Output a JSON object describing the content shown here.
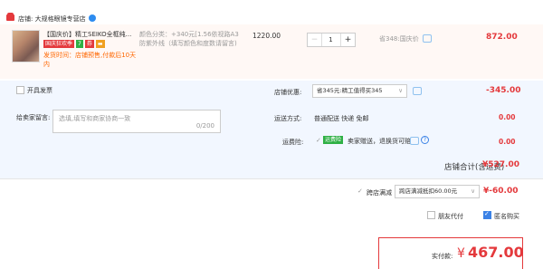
{
  "shop": {
    "label": "店铺: 大规格眼镜专营店"
  },
  "item": {
    "title": "【国庆价】精工SEIKO全框纯...",
    "tags": [
      "国庆狂欢季",
      "7",
      "券",
      "▬"
    ],
    "shipping_note": "发货时间：店铺预售,付款后10天内",
    "spec": "颜色分类：+340元[1.56依视路A3防紫外线（填写颜色和度数请留言)",
    "unit_price": "1220.00",
    "quantity": "1",
    "discount_note": "省348:国庆价",
    "subtotal": "872.00"
  },
  "invoice": {
    "label": "开具发票"
  },
  "shop_discount": {
    "label": "店铺优惠:",
    "selected": "省345元:精工值得买345",
    "amount": "-345.00"
  },
  "message": {
    "label": "给卖家留言:",
    "placeholder": "选填,填写和商家协商一致",
    "counter": "0/200"
  },
  "delivery": {
    "label": "运送方式:",
    "value": "普通配送 快递 免邮",
    "fee": "0.00"
  },
  "insurance": {
    "label": "运费险:",
    "badge": "运费险",
    "text": "卖家赠送，退换货可赔",
    "fee": "0.00"
  },
  "shop_total": {
    "label": "店铺合计(含运费)",
    "amount": "¥527.00"
  },
  "cross_shop": {
    "label": "跨店满减",
    "selected": "跨店满减抵扣60.00元",
    "amount": "¥-60.00"
  },
  "options": {
    "friend_pay": "朋友代付",
    "anonymous": "匿名购买"
  },
  "payment": {
    "label": "实付款:",
    "currency": "¥",
    "amount": "467.00"
  },
  "colors": {
    "accent": "#e4393c",
    "blue": "#3b82e6",
    "green": "#2fb045"
  }
}
